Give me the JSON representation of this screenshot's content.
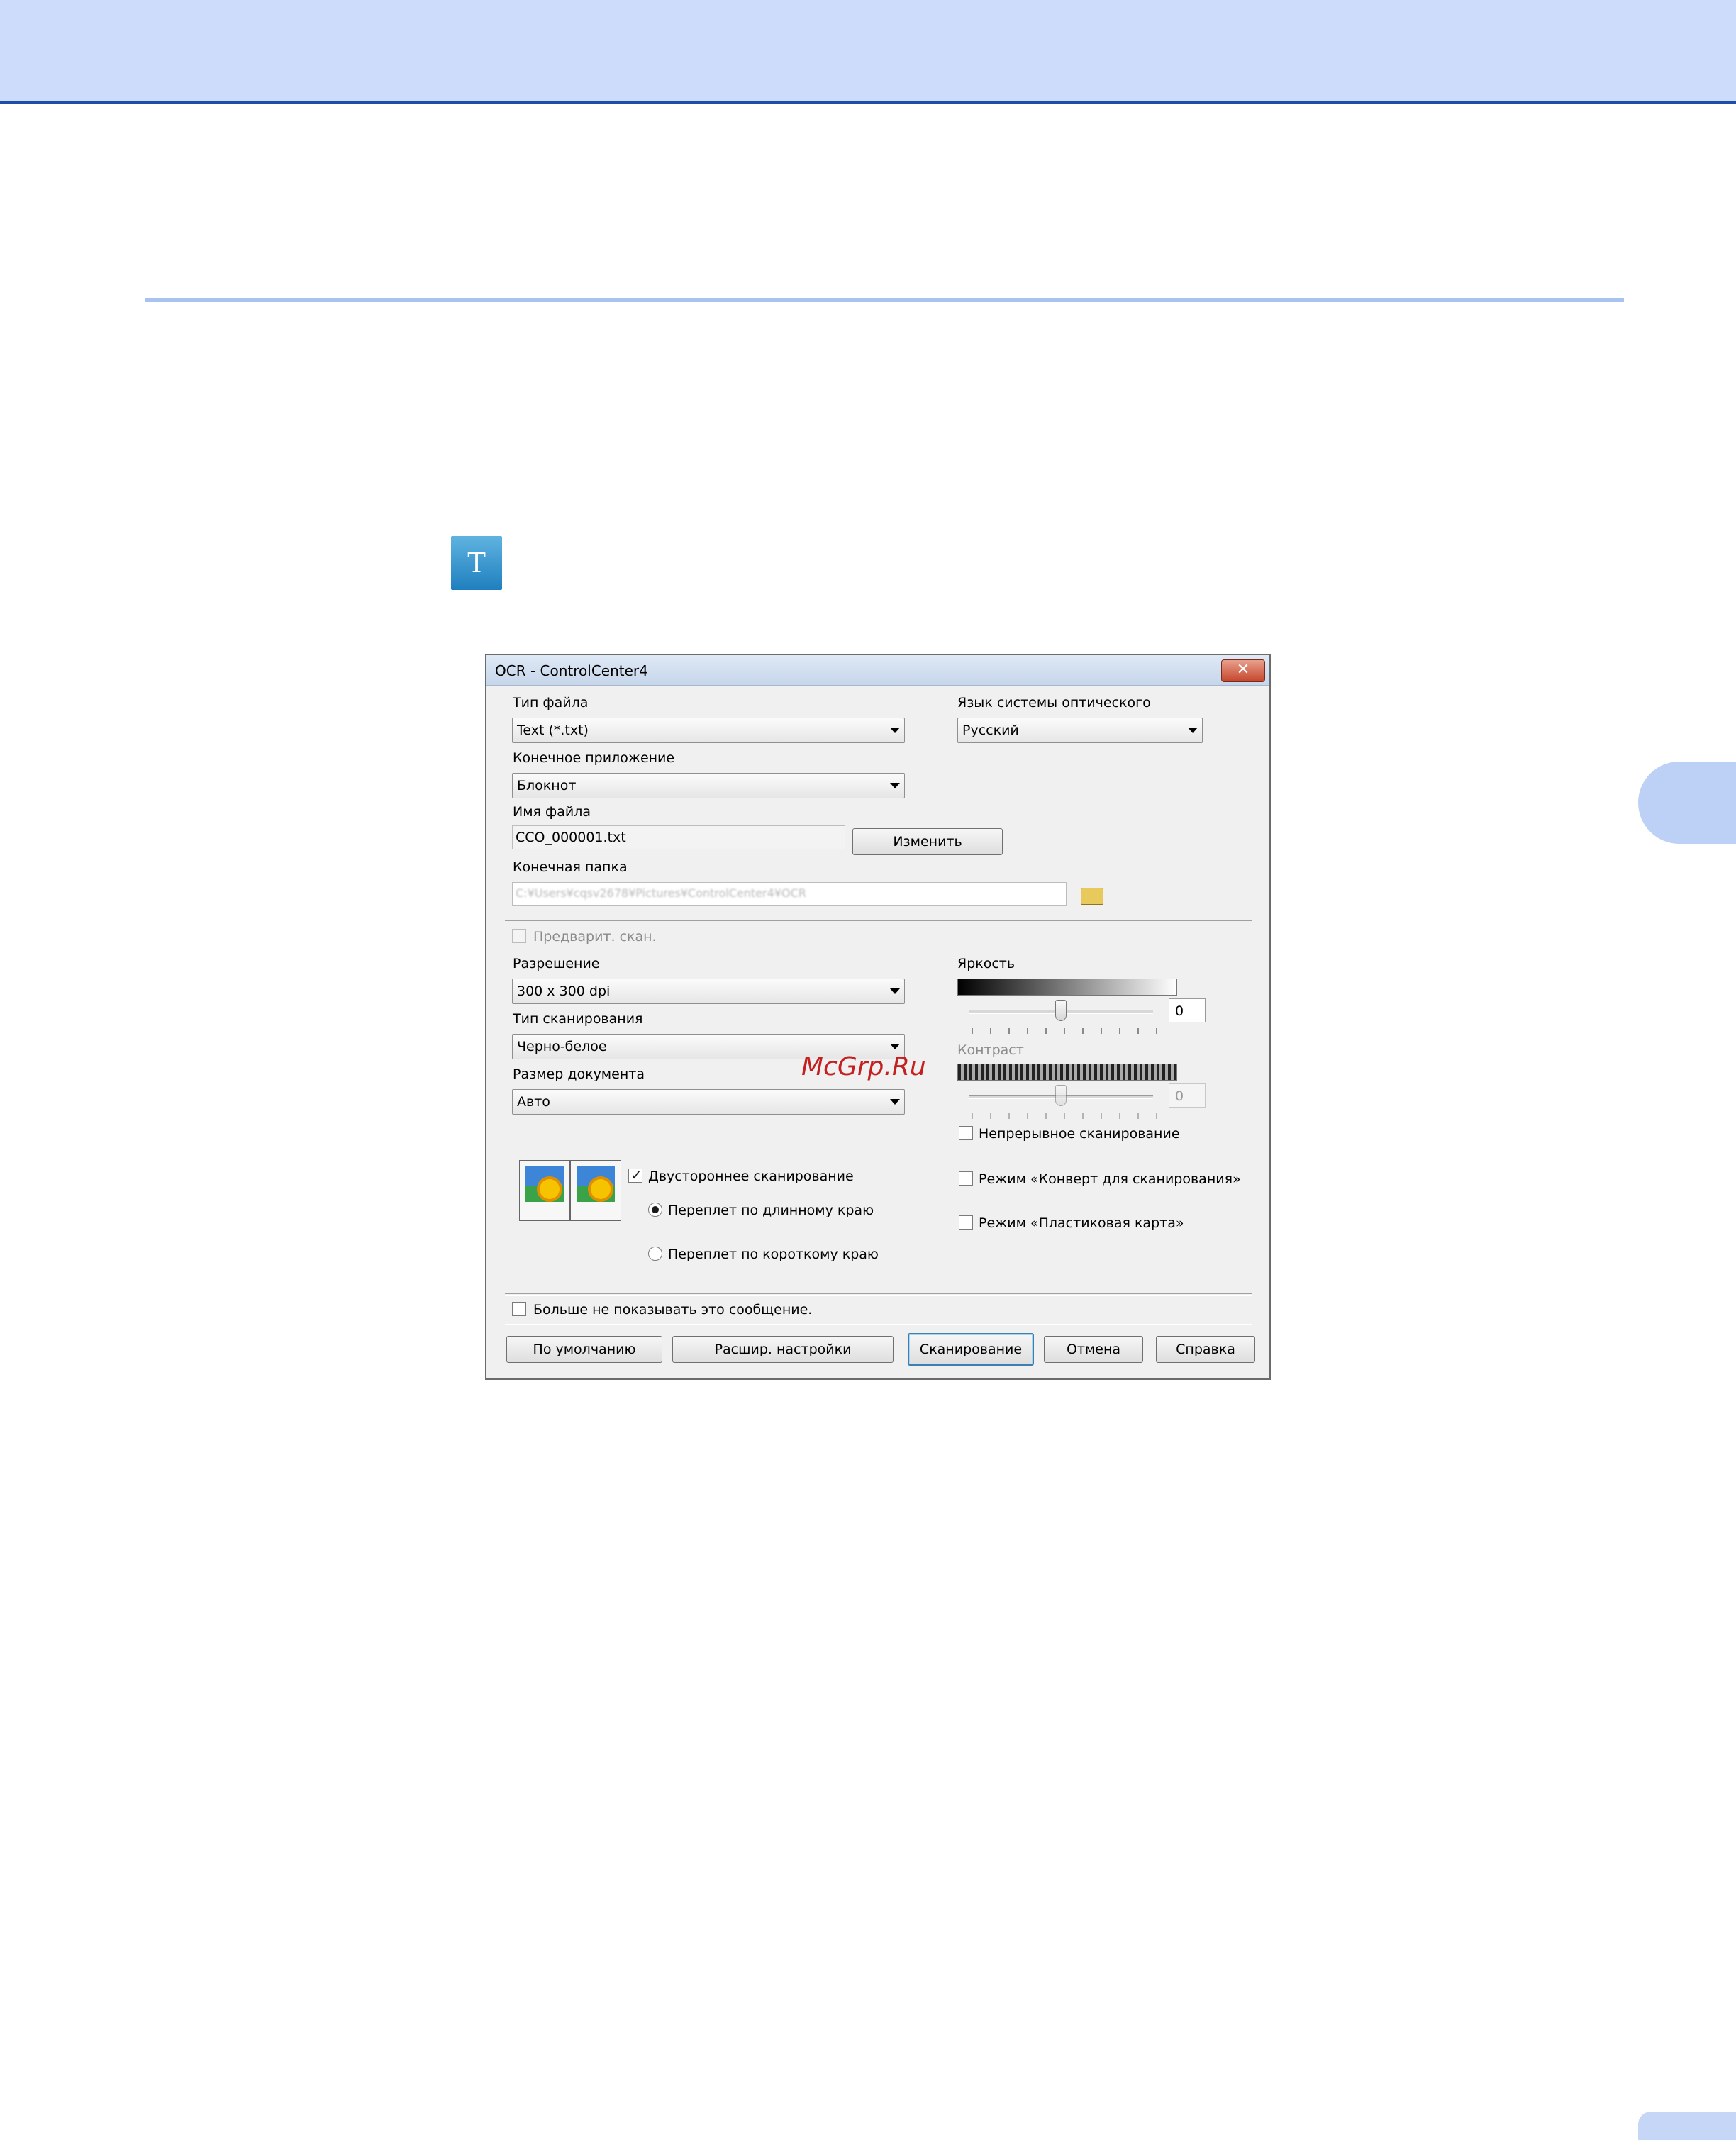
{
  "icon_label": "T",
  "dialog": {
    "title": "OCR - ControlCenter4",
    "close_symbol": "✕",
    "file_type": {
      "label": "Тип файла",
      "value": "Text (*.txt)"
    },
    "ocr_language": {
      "label": "Язык системы оптического",
      "value": "Русский"
    },
    "target_app": {
      "label": "Конечное приложение",
      "value": "Блокнот"
    },
    "file_name": {
      "label": "Имя файла",
      "value": "CCO_000001.txt",
      "change_button": "Изменить"
    },
    "dest_folder": {
      "label": "Конечная папка",
      "value": "C:¥Users¥cqsv2678¥Pictures¥ControlCenter4¥OCR"
    },
    "prescan": {
      "label": "Предварит. скан.",
      "checked": false,
      "enabled": false
    },
    "resolution": {
      "label": "Разрешение",
      "value": "300 x 300  dpi"
    },
    "scan_type": {
      "label": "Тип сканирования",
      "value": "Черно-белое"
    },
    "doc_size": {
      "label": "Размер документа",
      "value": "Авто"
    },
    "brightness": {
      "label": "Яркость",
      "value": "0",
      "level": 0.5
    },
    "contrast": {
      "label": "Контраст",
      "value": "0",
      "level": 0.5,
      "enabled": false
    },
    "continuous_scan": {
      "label": "Непрерывное сканирование",
      "checked": false
    },
    "envelope_mode": {
      "label": "Режим «Конверт для сканирования»",
      "checked": false
    },
    "plastic_card_mode": {
      "label": "Режим «Пластиковая карта»",
      "checked": false
    },
    "duplex": {
      "label": "Двустороннее сканирование",
      "checked": true
    },
    "binding_long": {
      "label": "Переплет по длинному краю",
      "selected": true
    },
    "binding_short": {
      "label": "Переплет по короткому краю",
      "selected": false
    },
    "dont_show": {
      "label": "Больше не показывать это сообщение.",
      "checked": false
    },
    "buttons": {
      "default": "По умолчанию",
      "advanced": "Расшир. настройки",
      "scan": "Сканирование",
      "cancel": "Отмена",
      "help": "Справка"
    }
  },
  "watermark": "McGrp.Ru",
  "colors": {
    "header_band": "#cddcfb",
    "header_line": "#1f4ea8",
    "rule": "#a8c2f2",
    "side_tab": "#bdd0f5"
  }
}
